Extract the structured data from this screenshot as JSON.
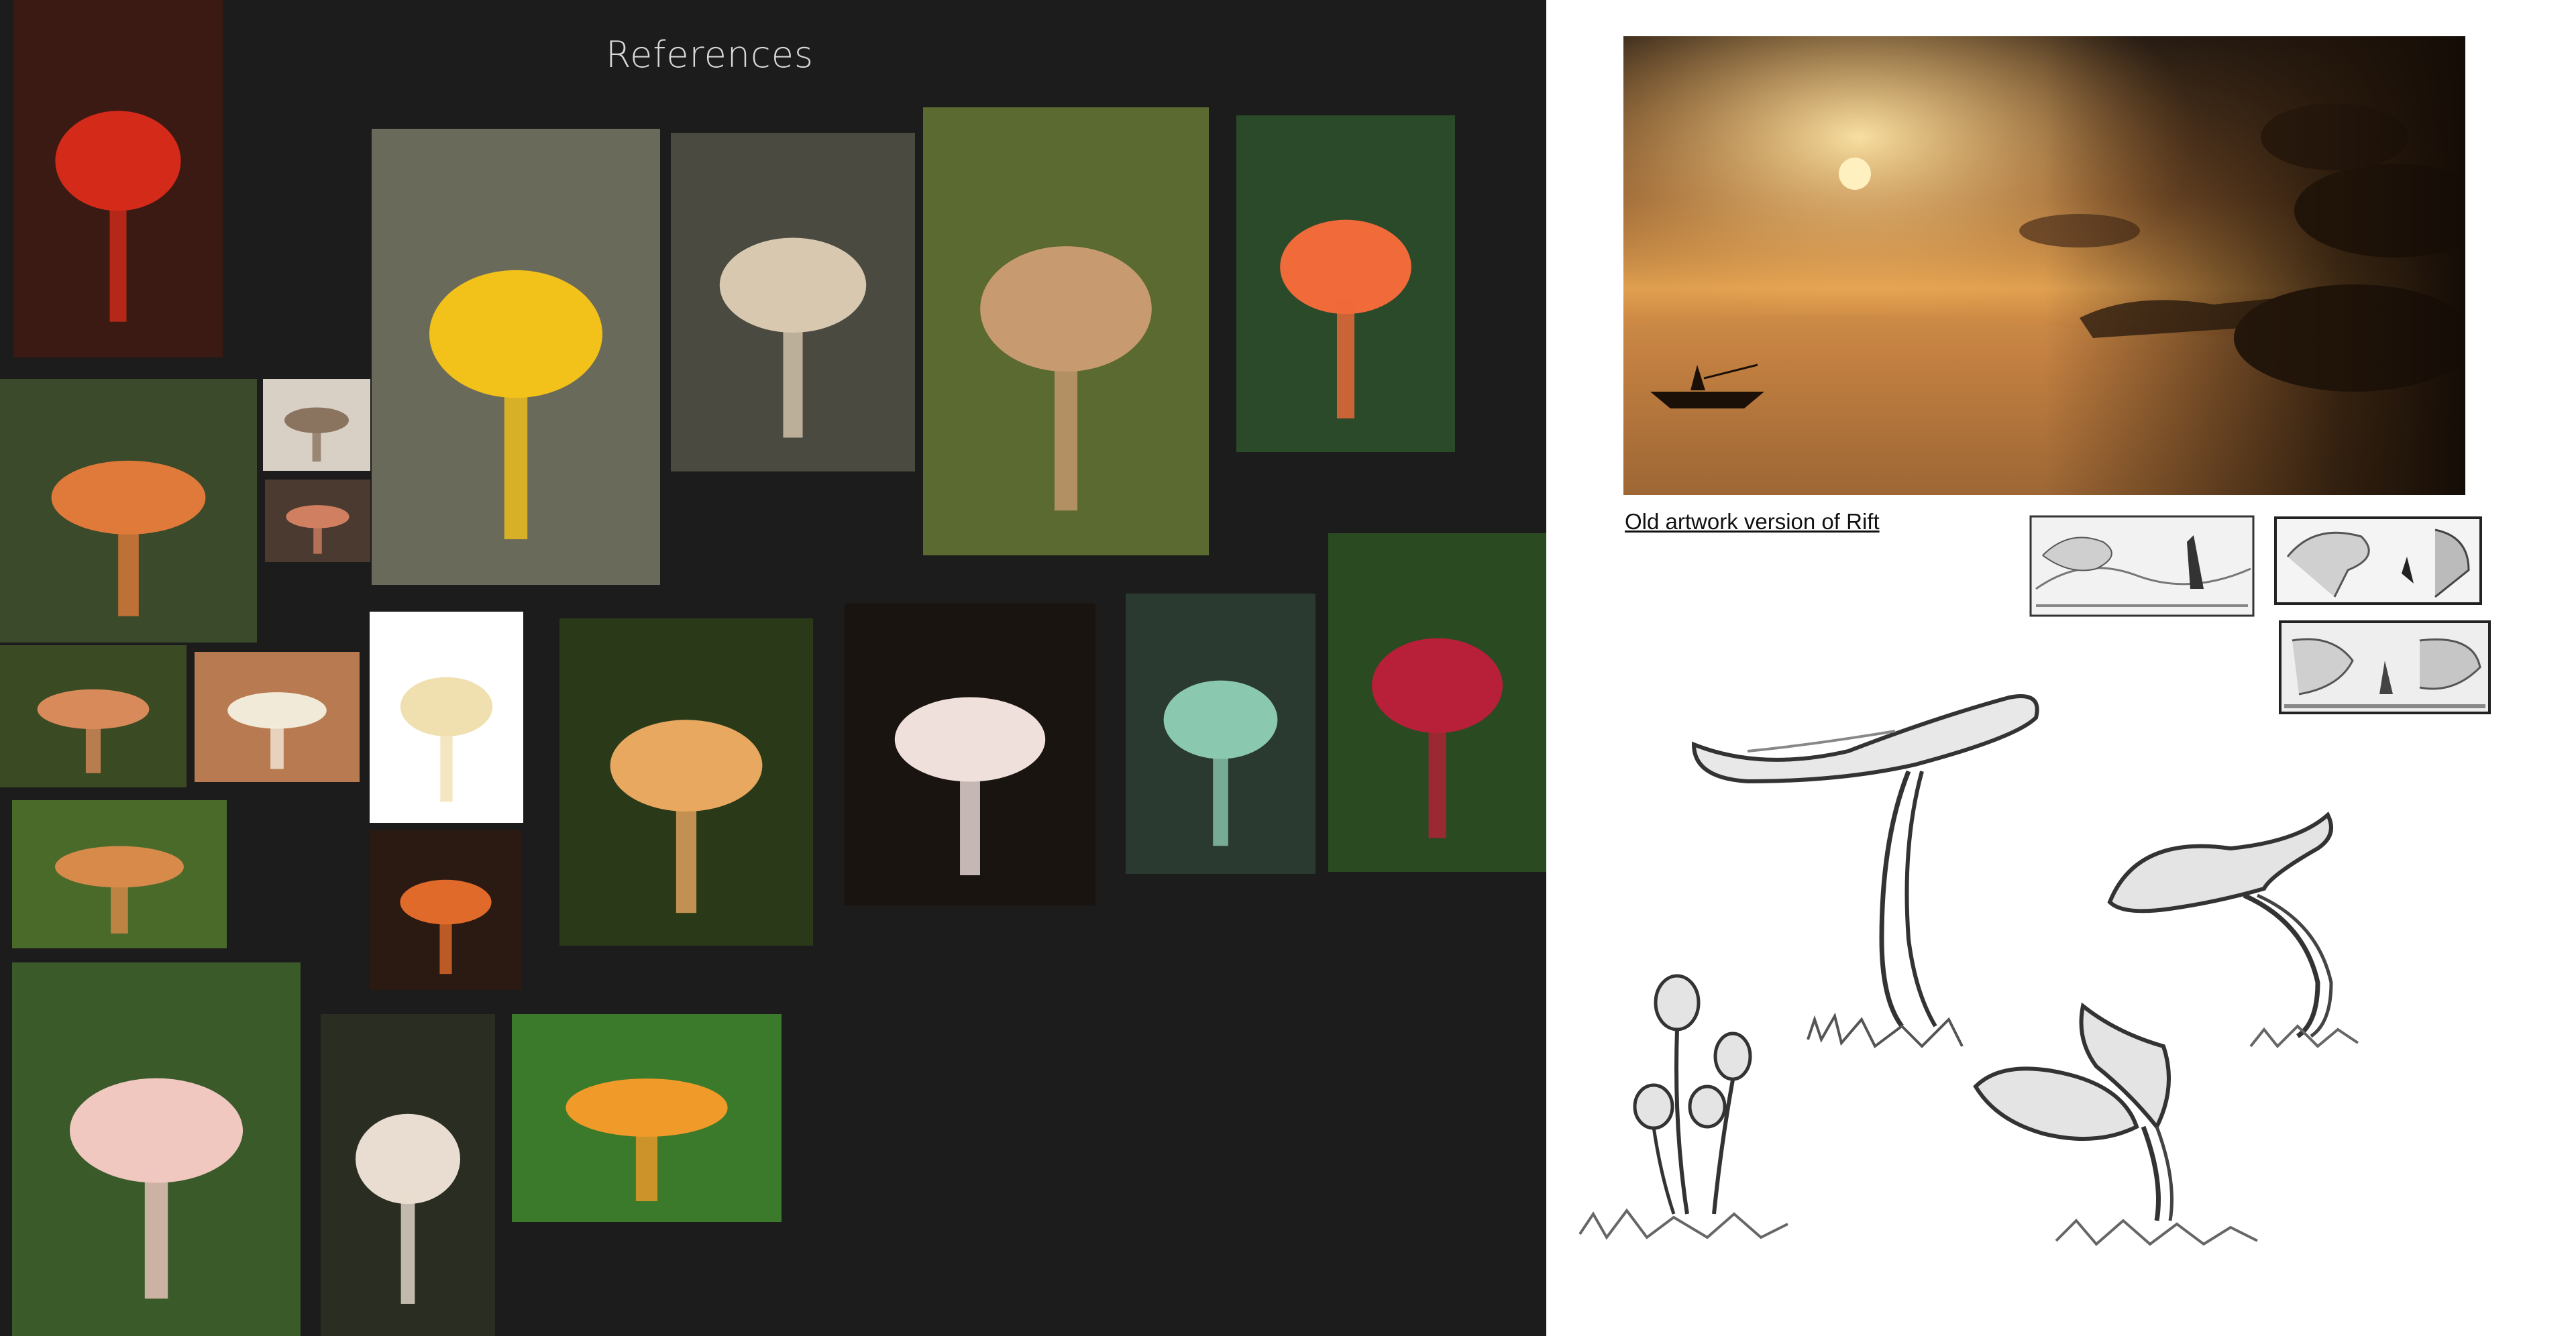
{
  "references": {
    "title": "References",
    "photos": [
      {
        "name": "red-cup-fungi-photo",
        "bg": "#3a1a12",
        "accent": "#d42a1a"
      },
      {
        "name": "orange-mushroom-hand-photo",
        "bg": "#3b4a2a",
        "accent": "#e07a3a"
      },
      {
        "name": "oyster-mushroom-small-photo",
        "bg": "#d8d0c4",
        "accent": "#8a7460"
      },
      {
        "name": "small-orange-mushroom-photo",
        "bg": "#4a3a30",
        "accent": "#d08060"
      },
      {
        "name": "orange-mushrooms-moss-photo",
        "bg": "#3a4a22",
        "accent": "#d88a5a"
      },
      {
        "name": "enoki-cluster-photo",
        "bg": "#b87a50",
        "accent": "#f2ead8"
      },
      {
        "name": "orange-mushrooms-forest-photo",
        "bg": "#4a6a2a",
        "accent": "#d88a4a"
      },
      {
        "name": "pink-shelf-fungi-forest-photo",
        "bg": "#3a5a2a",
        "accent": "#f0c8c0"
      },
      {
        "name": "yellow-oyster-tree-photo",
        "bg": "#6a6a5a",
        "accent": "#f2c21a"
      },
      {
        "name": "enoki-white-photo",
        "bg": "#ffffff",
        "accent": "#f0e0b0"
      },
      {
        "name": "orange-mushroom-dark-photo",
        "bg": "#2a1a12",
        "accent": "#e06a2a"
      },
      {
        "name": "white-mushrooms-forest-photo",
        "bg": "#2a2e22",
        "accent": "#e8ddd0"
      },
      {
        "name": "shelf-fungi-birch-photo",
        "bg": "#4a4a40",
        "accent": "#d8c8b0"
      },
      {
        "name": "chanterelles-ferns-photo",
        "bg": "#2a3a18",
        "accent": "#e8a860"
      },
      {
        "name": "chanterelle-green-photo",
        "bg": "#3a7a2a",
        "accent": "#f09a2a"
      },
      {
        "name": "bracket-fungi-tree-photo",
        "bg": "#5a6a30",
        "accent": "#c89a70"
      },
      {
        "name": "white-fan-fungus-photo",
        "bg": "#1a1410",
        "accent": "#f0e0dc"
      },
      {
        "name": "orange-shelf-mossy-photo",
        "bg": "#2a4a2a",
        "accent": "#f06a3a"
      },
      {
        "name": "lichen-bark-photo",
        "bg": "#2a3a30",
        "accent": "#8ac8b0"
      },
      {
        "name": "red-hanging-fungi-photo",
        "bg": "#2a4a22",
        "accent": "#b8203a"
      }
    ]
  },
  "artwork": {
    "caption": "Old artwork version of Rift",
    "colors": {
      "sky_top": "#3a2a1c",
      "sun": "#ffd27a",
      "water": "#c07a3a",
      "shadow": "#1e1208"
    }
  },
  "sketches": {
    "thumbnails": [
      "thumbnail-sketch-1",
      "thumbnail-sketch-2",
      "thumbnail-sketch-3"
    ],
    "mushrooms": [
      "mushroom-sketch-large",
      "mushroom-sketch-cluster",
      "mushroom-sketch-bent",
      "mushroom-sketch-curled"
    ]
  }
}
